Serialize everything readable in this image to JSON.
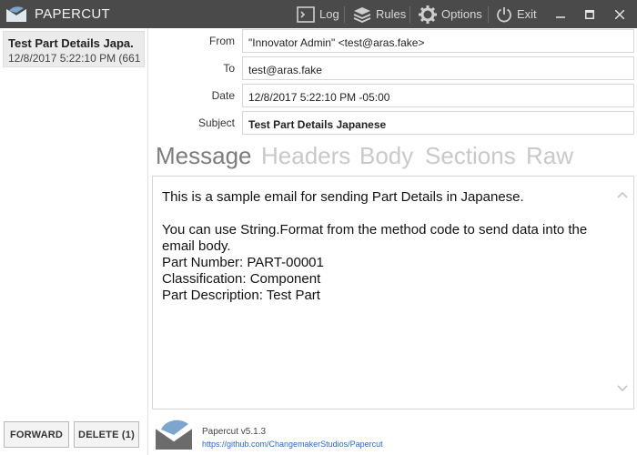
{
  "titlebar": {
    "app_name": "PAPERCUT",
    "buttons": {
      "log": "Log",
      "rules": "Rules",
      "options": "Options",
      "exit": "Exit"
    }
  },
  "messages": [
    {
      "subject": "Test Part Details Japa.",
      "date": "12/8/2017 5:22:10 PM (661"
    }
  ],
  "actions": {
    "forward": "FORWARD",
    "delete": "DELETE (1)"
  },
  "headers": {
    "from_label": "From",
    "from_value": "\"Innovator Admin\" <test@aras.fake>",
    "to_label": "To",
    "to_value": "test@aras.fake",
    "date_label": "Date",
    "date_value": "12/8/2017 5:22:10 PM -05:00",
    "subject_label": "Subject",
    "subject_value": "Test Part Details Japanese"
  },
  "tabs": [
    "Message",
    "Headers",
    "Body",
    "Sections",
    "Raw"
  ],
  "active_tab": "Message",
  "body": {
    "line1": "This is a sample email for sending Part Details in Japanese.",
    "line2": "You can use String.Format from the method code to send data into the email body.",
    "line3": "Part Number: PART-00001",
    "line4": "Classification: Component",
    "line5": "Part Description: Test Part"
  },
  "footer": {
    "version": "Papercut v5.1.3",
    "link": "https://github.com/ChangemakerStudios/Papercut"
  },
  "colors": {
    "titlebar": "#4a4a4a",
    "selected_item": "#ebebeb",
    "active_tab": "#7d7d7d",
    "inactive_tab": "#c9c9c9",
    "link": "#2a6bbf"
  }
}
